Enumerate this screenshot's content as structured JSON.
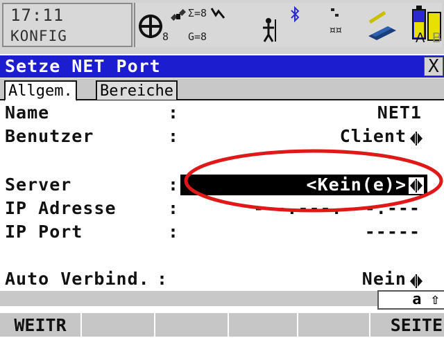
{
  "status": {
    "time": "17:11",
    "mode": "KONFIG",
    "sat_count_label": "8",
    "sigma_label": "Σ=8",
    "g_label": "G=8",
    "memory_labels": [
      "A",
      "B"
    ]
  },
  "icons": [
    "position-crosshair-icon",
    "satellite-icon",
    "antenna-pole-icon",
    "bluetooth-icon",
    "radio-link-icon",
    "sd-card-icon",
    "battery-icon"
  ],
  "window": {
    "title": "Setze NET Port",
    "close": "X"
  },
  "tabs": [
    {
      "label": "Allgem.",
      "active": true
    },
    {
      "label": "Bereiche",
      "active": false
    }
  ],
  "fields": {
    "name": {
      "label": "Name",
      "colon": ":",
      "value": "NET1"
    },
    "user": {
      "label": "Benutzer",
      "colon": ":",
      "value": "Client"
    },
    "server": {
      "label": "Server",
      "colon": ":",
      "value": "<Kein(e)>"
    },
    "ip_address": {
      "label": "IP Adresse",
      "colon": ":",
      "value": "---.---.---.---"
    },
    "ip_port": {
      "label": "IP Port",
      "colon": ":",
      "value": "-----"
    },
    "auto_connect": {
      "label": "Auto Verbind.",
      "colon": ":",
      "value": "Nein"
    }
  },
  "input_mode": "a ⇧",
  "function_keys": [
    "WEITR",
    "",
    "",
    "",
    "",
    "SEITE"
  ],
  "colors": {
    "title_bar": "#1d1dd0",
    "highlight_circle": "#e01818",
    "selection": "#000000"
  }
}
